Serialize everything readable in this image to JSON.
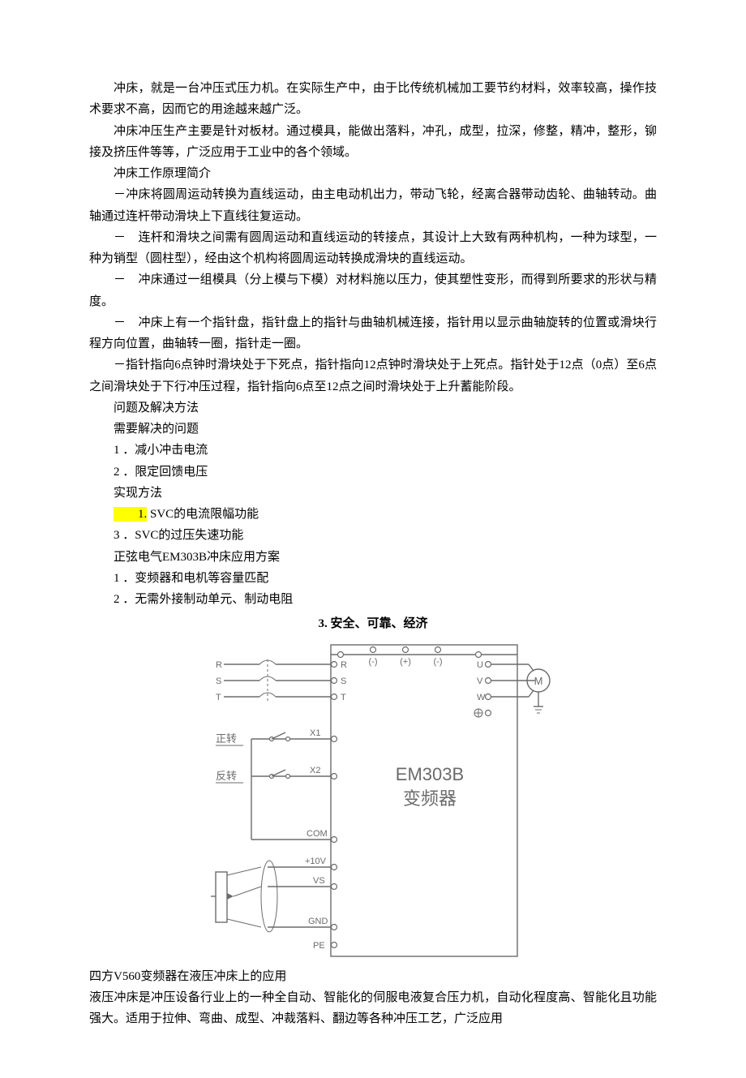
{
  "body": {
    "p1": "冲床，就是一台冲压式压力机。在实际生产中，由于比传统机械加工要节约材料，效率较高，操作技术要求不高，因而它的用途越来越广泛。",
    "p2": "冲床冲压生产主要是针对板材。通过模具，能做出落料，冲孔，成型，拉深，修整，精冲，整形，铆接及挤压件等等，广泛应用于工业中的各个领域。",
    "p3": "冲床工作原理简介",
    "p4": "－冲床将圆周运动转换为直线运动，由主电动机出力，带动飞轮，经离合器带动齿轮、曲轴转动。曲轴通过连杆带动滑块上下直线往复运动。",
    "p5": "－　连杆和滑块之间需有圆周运动和直线运动的转接点，其设计上大致有两种机构，一种为球型，一种为销型（圆柱型），经由这个机构将圆周运动转换成滑块的直线运动。",
    "p6": "－　冲床通过一组模具（分上模与下模）对材料施以压力，使其塑性变形，而得到所要求的形状与精度。",
    "p7": "－　冲床上有一个指针盘，指针盘上的指针与曲轴机械连接，指针用以显示曲轴旋转的位置或滑块行程方向位置，曲轴转一圈，指针走一圈。",
    "p8": "－指针指向6点钟时滑块处于下死点，指针指向12点钟时滑块处于上死点。指针处于12点（0点）至6点之间滑块处于下行冲压过程，指针指向6点至12点之间时滑块处于上升蓄能阶段。",
    "s1": "问题及解决方法",
    "s2": "需要解决的问题",
    "l1": "1 ．减小冲击电流",
    "l2": "2 ．限定回馈电压",
    "s3": "实现方法",
    "l3_hi": "1.",
    "l3_rest": " SVC的电流限幅功能",
    "l4": "3 ．SVC的过压失速功能",
    "s4": "正弦电气EM303B冲床应用方案",
    "l5": "1 ．变频器和电机等容量匹配",
    "l6": "2 ．无需外接制动单元、制动电阻",
    "h_safe": "3. 安全、可靠、经济",
    "after1": "四方V560变频器在液压冲床上的应用",
    "after2": "液压冲床是冲压设备行业上的一种全自动、智能化的伺服电液复合压力机，自动化程度高、智能化且功能强大。适用于拉伸、弯曲、成型、冲裁落料、翻边等各种冲压工艺，广泛应用"
  },
  "diagram": {
    "title1": "EM303B",
    "title2": "变频器",
    "R": "R",
    "S": "S",
    "T": "T",
    "fwd": "正转",
    "rev": "反转",
    "X1": "X1",
    "X2": "X2",
    "COM": "COM",
    "p10v": "+10V",
    "VS": "VS",
    "GND": "GND",
    "PE": "PE",
    "minus": "(-)",
    "plus": "(+)",
    "minus2": "(-)",
    "U": "U",
    "V": "V",
    "W": "W",
    "M": "M"
  }
}
